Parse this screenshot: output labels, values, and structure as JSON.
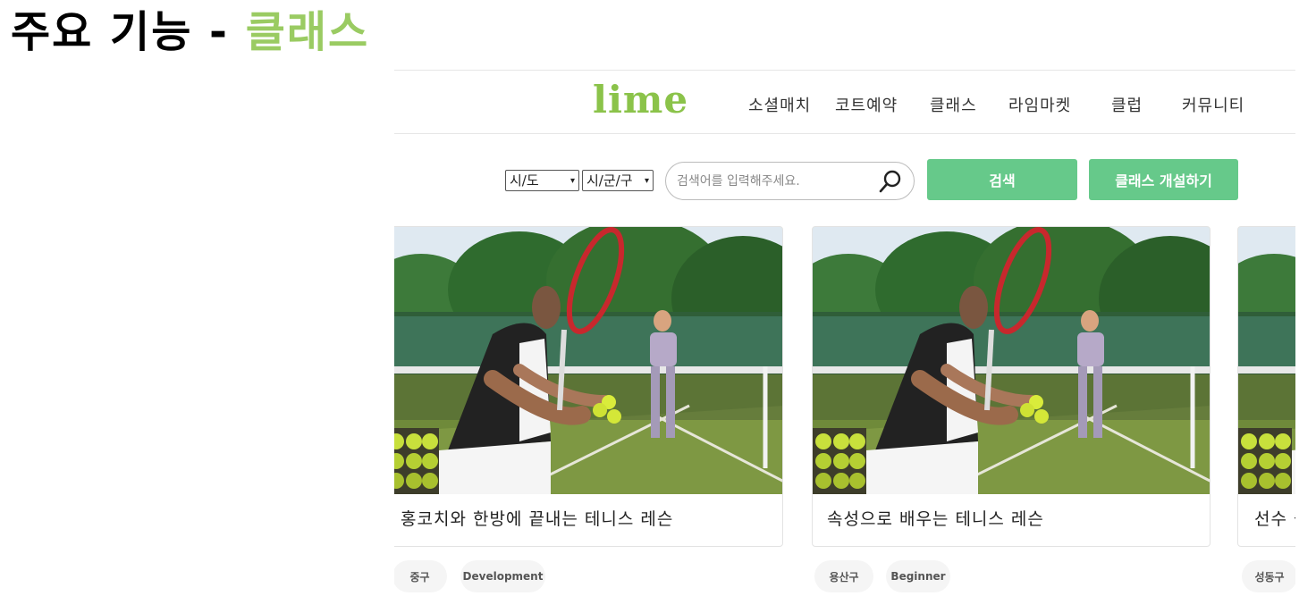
{
  "slide": {
    "title_prefix": "주요 기능 - ",
    "title_highlight": "클래스"
  },
  "header": {
    "logo": "lime",
    "nav": [
      "소셜매치",
      "코트예약",
      "클래스",
      "라임마켓",
      "클럽",
      "커뮤니티"
    ]
  },
  "filters": {
    "region_select": "시/도",
    "district_select": "시/군/구",
    "search_placeholder": "검색어를 입력해주세요.",
    "search_button": "검색",
    "create_button": "클래스 개설하기"
  },
  "cards": [
    {
      "title": "홍코치와 한방에 끝내는 테니스 레슨",
      "tags": [
        "중구",
        "Development"
      ]
    },
    {
      "title": "속성으로 배우는 테니스 레슨",
      "tags": [
        "용산구",
        "Beginner"
      ]
    },
    {
      "title": "선수 출",
      "tags": [
        "성동구"
      ]
    }
  ],
  "colors": {
    "accent_green": "#66c98a",
    "logo_green": "#8bc34a",
    "title_green": "#9acb62"
  }
}
